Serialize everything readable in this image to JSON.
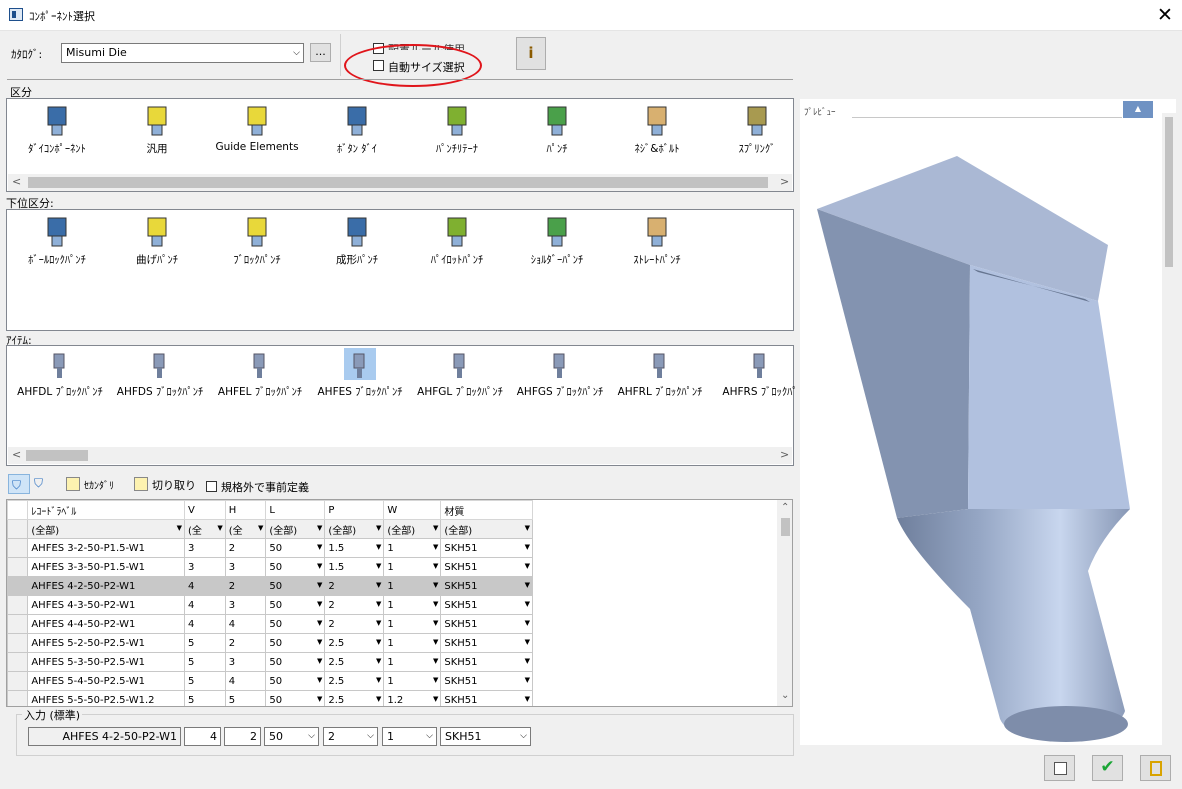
{
  "window": {
    "title": "ｺﾝﾎﾟｰﾈﾝﾄ選択",
    "close_glyph": "✕"
  },
  "catalog": {
    "label": "ｶﾀﾛｸﾞ:",
    "value": "Misumi Die",
    "browse_label": "..."
  },
  "options": {
    "rule_label": "配置ルール使用",
    "auto_size_label": "自動サイズ選択",
    "info_glyph": "i",
    "auto_size_highlight": "#e0151b"
  },
  "category": {
    "label": "区分",
    "items": [
      {
        "label": "ﾀﾞｲｺﾝﾎﾟｰﾈﾝﾄ",
        "icon": "die-component-icon"
      },
      {
        "label": "汎用",
        "icon": "general-icon"
      },
      {
        "label": "Guide Elements",
        "icon": "guide-elements-icon"
      },
      {
        "label": "ﾎﾞﾀﾝ ﾀﾞｲ",
        "icon": "button-die-icon"
      },
      {
        "label": "ﾊﾟﾝﾁﾘﾃｰﾅ",
        "icon": "punch-retainer-icon"
      },
      {
        "label": "ﾊﾟﾝﾁ",
        "icon": "punch-icon"
      },
      {
        "label": "ﾈｼﾞ&ﾎﾞﾙﾄ",
        "icon": "screw-bolt-icon"
      },
      {
        "label": "ｽﾌﾟﾘﾝｸﾞ",
        "icon": "spring-icon"
      }
    ]
  },
  "subcategory": {
    "label": "下位区分:",
    "items": [
      {
        "label": "ﾎﾞｰﾙﾛｯｸﾊﾟﾝﾁ",
        "icon": "ball-lock-punch-icon"
      },
      {
        "label": "曲げﾊﾟﾝﾁ",
        "icon": "bending-punch-icon"
      },
      {
        "label": "ﾌﾞﾛｯｸﾊﾟﾝﾁ",
        "icon": "block-punch-icon"
      },
      {
        "label": "成形ﾊﾟﾝﾁ",
        "icon": "forming-punch-icon"
      },
      {
        "label": "ﾊﾟｲﾛｯﾄﾊﾟﾝﾁ",
        "icon": "pilot-punch-icon"
      },
      {
        "label": "ｼｮﾙﾀﾞｰﾊﾟﾝﾁ",
        "icon": "shoulder-punch-icon"
      },
      {
        "label": "ｽﾄﾚｰﾄﾊﾟﾝﾁ",
        "icon": "straight-punch-icon"
      }
    ]
  },
  "items": {
    "label": "ｱｲﾃﾑ:",
    "list": [
      "AHFDL ﾌﾞﾛｯｸﾊﾟﾝﾁ",
      "AHFDS ﾌﾞﾛｯｸﾊﾟﾝﾁ",
      "AHFEL ﾌﾞﾛｯｸﾊﾟﾝﾁ",
      "AHFES ﾌﾞﾛｯｸﾊﾟﾝﾁ",
      "AHFGL ﾌﾞﾛｯｸﾊﾟﾝﾁ",
      "AHFGS ﾌﾞﾛｯｸﾊﾟﾝﾁ",
      "AHFRL ﾌﾞﾛｯｸﾊﾟﾝﾁ",
      "AHFRS ﾌﾞﾛｯｸﾊﾟ"
    ]
  },
  "toolbar": {
    "secondary_label": "ｾｶﾝﾀﾞﾘ",
    "cut_label": "切り取り",
    "predefine_label": "規格外で事前定義"
  },
  "table": {
    "columns": [
      "ﾚｺｰﾄﾞﾗﾍﾞﾙ",
      "V",
      "H",
      "L",
      "P",
      "W",
      "材質"
    ],
    "filters": [
      "(全部)",
      "(全",
      "(全",
      "(全部)",
      "(全部)",
      "(全部)",
      "(全部)"
    ],
    "rows": [
      [
        "AHFES 3-2-50-P1.5-W1",
        "3",
        "2",
        "50",
        "1.5",
        "1",
        "SKH51"
      ],
      [
        "AHFES 3-3-50-P1.5-W1",
        "3",
        "3",
        "50",
        "1.5",
        "1",
        "SKH51"
      ],
      [
        "AHFES 4-2-50-P2-W1",
        "4",
        "2",
        "50",
        "2",
        "1",
        "SKH51"
      ],
      [
        "AHFES 4-3-50-P2-W1",
        "4",
        "3",
        "50",
        "2",
        "1",
        "SKH51"
      ],
      [
        "AHFES 4-4-50-P2-W1",
        "4",
        "4",
        "50",
        "2",
        "1",
        "SKH51"
      ],
      [
        "AHFES 5-2-50-P2.5-W1",
        "5",
        "2",
        "50",
        "2.5",
        "1",
        "SKH51"
      ],
      [
        "AHFES 5-3-50-P2.5-W1",
        "5",
        "3",
        "50",
        "2.5",
        "1",
        "SKH51"
      ],
      [
        "AHFES 5-4-50-P2.5-W1",
        "5",
        "4",
        "50",
        "2.5",
        "1",
        "SKH51"
      ],
      [
        "AHFES 5-5-50-P2.5-W1.2",
        "5",
        "5",
        "50",
        "2.5",
        "1.2",
        "SKH51"
      ]
    ]
  },
  "input": {
    "label": "入力 (標準)",
    "record": "AHFES 4-2-50-P2-W1",
    "v": "4",
    "h": "2",
    "l": "50",
    "p": "2",
    "w": "1",
    "material": "SKH51"
  },
  "preview": {
    "label": "ﾌﾟﾚﾋﾞｭｰ",
    "model_color": "#a8b9d8"
  },
  "footer": {
    "ok_glyph": "✔"
  }
}
